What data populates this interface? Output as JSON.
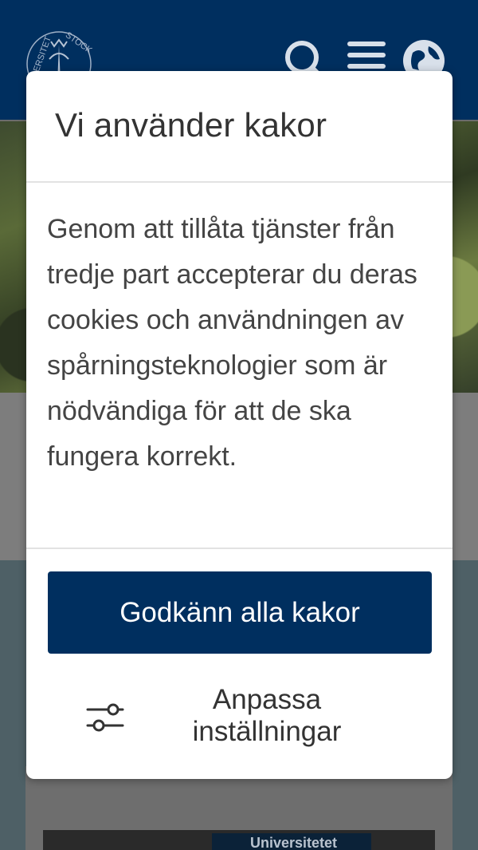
{
  "header": {
    "logo_icon": "university-seal-icon",
    "logo_text_left": "ERSITET",
    "logo_text_right": "STOCK",
    "icons": [
      "search-icon",
      "menu-icon",
      "globe-icon"
    ]
  },
  "background": {
    "photo_sign_text": "Universitetet"
  },
  "cookie_dialog": {
    "title": "Vi använder kakor",
    "body": "Genom att tillåta tjänster från tredje part accepterar du deras cookies och användningen av spårningsteknologier som är nödvändiga för att de ska fungera korrekt.",
    "accept_label": "Godkänn alla kakor",
    "customize_label": "Anpassa inställningar",
    "customize_icon": "sliders-icon",
    "accent_color": "#002f5f"
  }
}
